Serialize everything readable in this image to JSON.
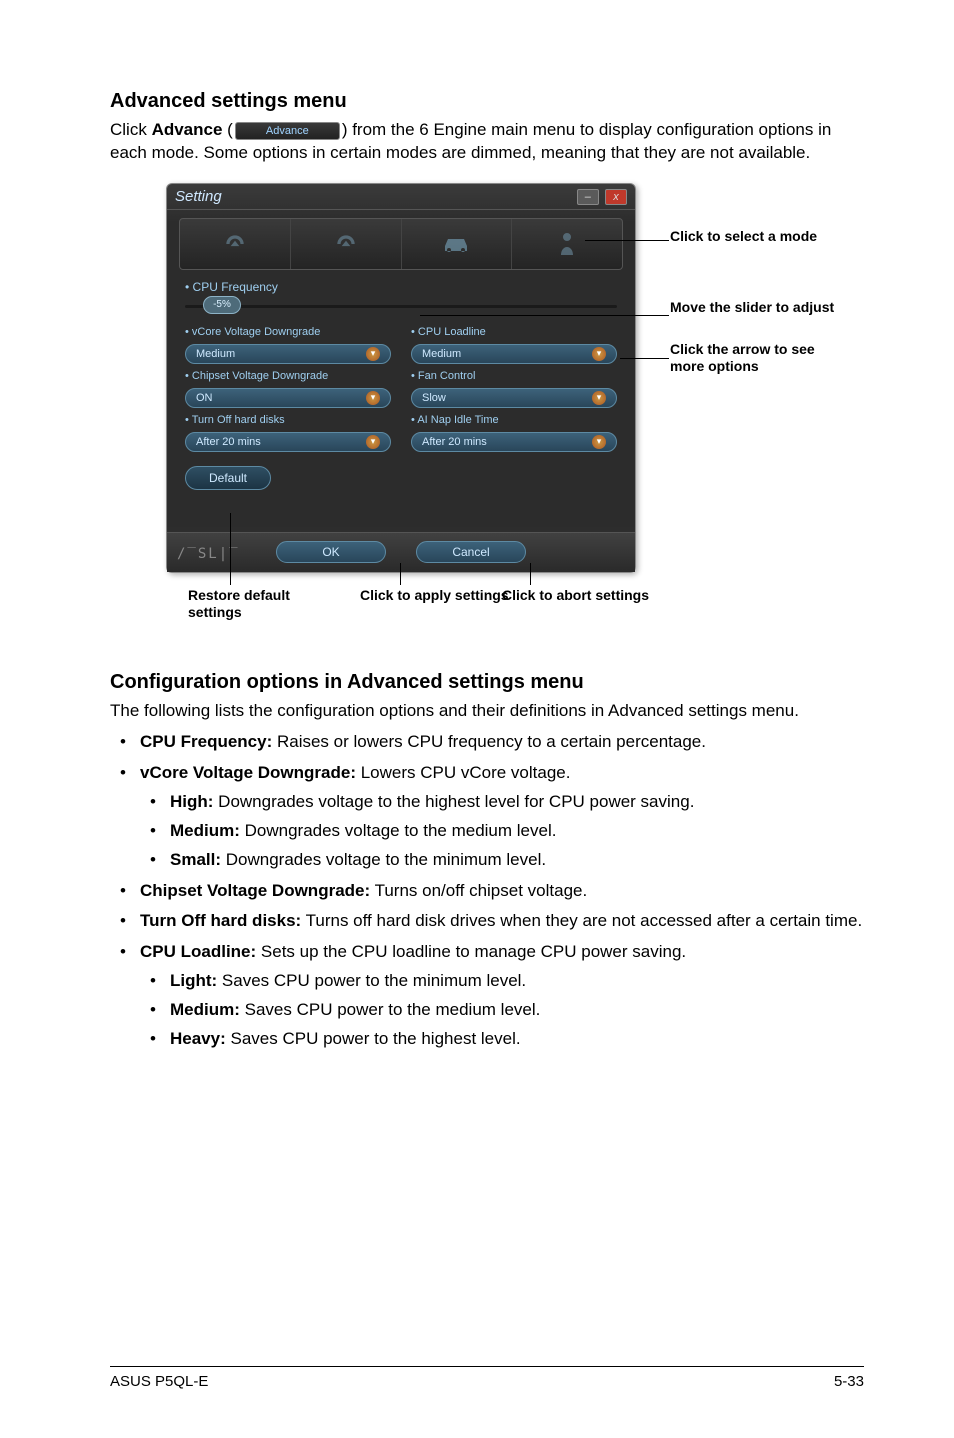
{
  "section1": {
    "heading": "Advanced settings menu",
    "p1a": "Click ",
    "p1_bold": "Advance",
    "p1b": " (",
    "advbtn": "Advance",
    "p1c": ") from the 6 Engine main menu to display configuration options in each mode. Some options in certain modes are dimmed, meaning that they are not available."
  },
  "window": {
    "title": "Setting",
    "cpu_freq_label": "CPU Frequency",
    "slider_value": "-5%",
    "labels": {
      "vcore": "vCore Voltage Downgrade",
      "cpuload": "CPU Loadline",
      "chipset": "Chipset Voltage Downgrade",
      "fan": "Fan Control",
      "turnoff": "Turn Off hard disks",
      "aiidle": "AI Nap Idle Time"
    },
    "values": {
      "vcore": "Medium",
      "cpuload": "Medium",
      "chipset": "ON",
      "fan": "Slow",
      "turnoff": "After 20 mins",
      "aiidle": "After 20 mins"
    },
    "default_btn": "Default",
    "ok": "OK",
    "cancel": "Cancel"
  },
  "callouts": {
    "mode": "Click to select a mode",
    "move": "Move the slider to adjust",
    "arrow": "Click the arrow to see more options",
    "restore": "Restore default settings",
    "apply": "Click to apply settings",
    "abort": "Click to abort settings"
  },
  "section2": {
    "heading": "Configuration options in Advanced settings menu",
    "intro": "The following lists the configuration options and their definitions in Advanced settings menu.",
    "items": {
      "cpu_freq_b": "CPU Frequency:",
      "cpu_freq_t": " Raises or lowers CPU frequency to a certain percentage.",
      "vcore_b": "vCore Voltage Downgrade:",
      "vcore_t": " Lowers CPU vCore voltage.",
      "vcore_high_b": "High:",
      "vcore_high_t": " Downgrades voltage to the highest level for CPU power saving.",
      "vcore_med_b": "Medium:",
      "vcore_med_t": " Downgrades voltage to the medium level.",
      "vcore_small_b": "Small:",
      "vcore_small_t": " Downgrades voltage to the minimum level.",
      "chipset_b": "Chipset Voltage Downgrade:",
      "chipset_t": " Turns on/off chipset voltage.",
      "turnoff_b": "Turn Off hard disks:",
      "turnoff_t": " Turns off hard disk drives when they are not accessed after a certain time.",
      "loadline_b": "CPU Loadline:",
      "loadline_t": " Sets up the CPU loadline to manage CPU power saving.",
      "ll_light_b": "Light:",
      "ll_light_t": " Saves CPU power to the minimum level.",
      "ll_med_b": "Medium:",
      "ll_med_t": " Saves CPU power to the medium level.",
      "ll_heavy_b": "Heavy:",
      "ll_heavy_t": " Saves CPU power to the highest level."
    }
  },
  "footer": {
    "left": "ASUS P5QL-E",
    "right": "5-33"
  }
}
